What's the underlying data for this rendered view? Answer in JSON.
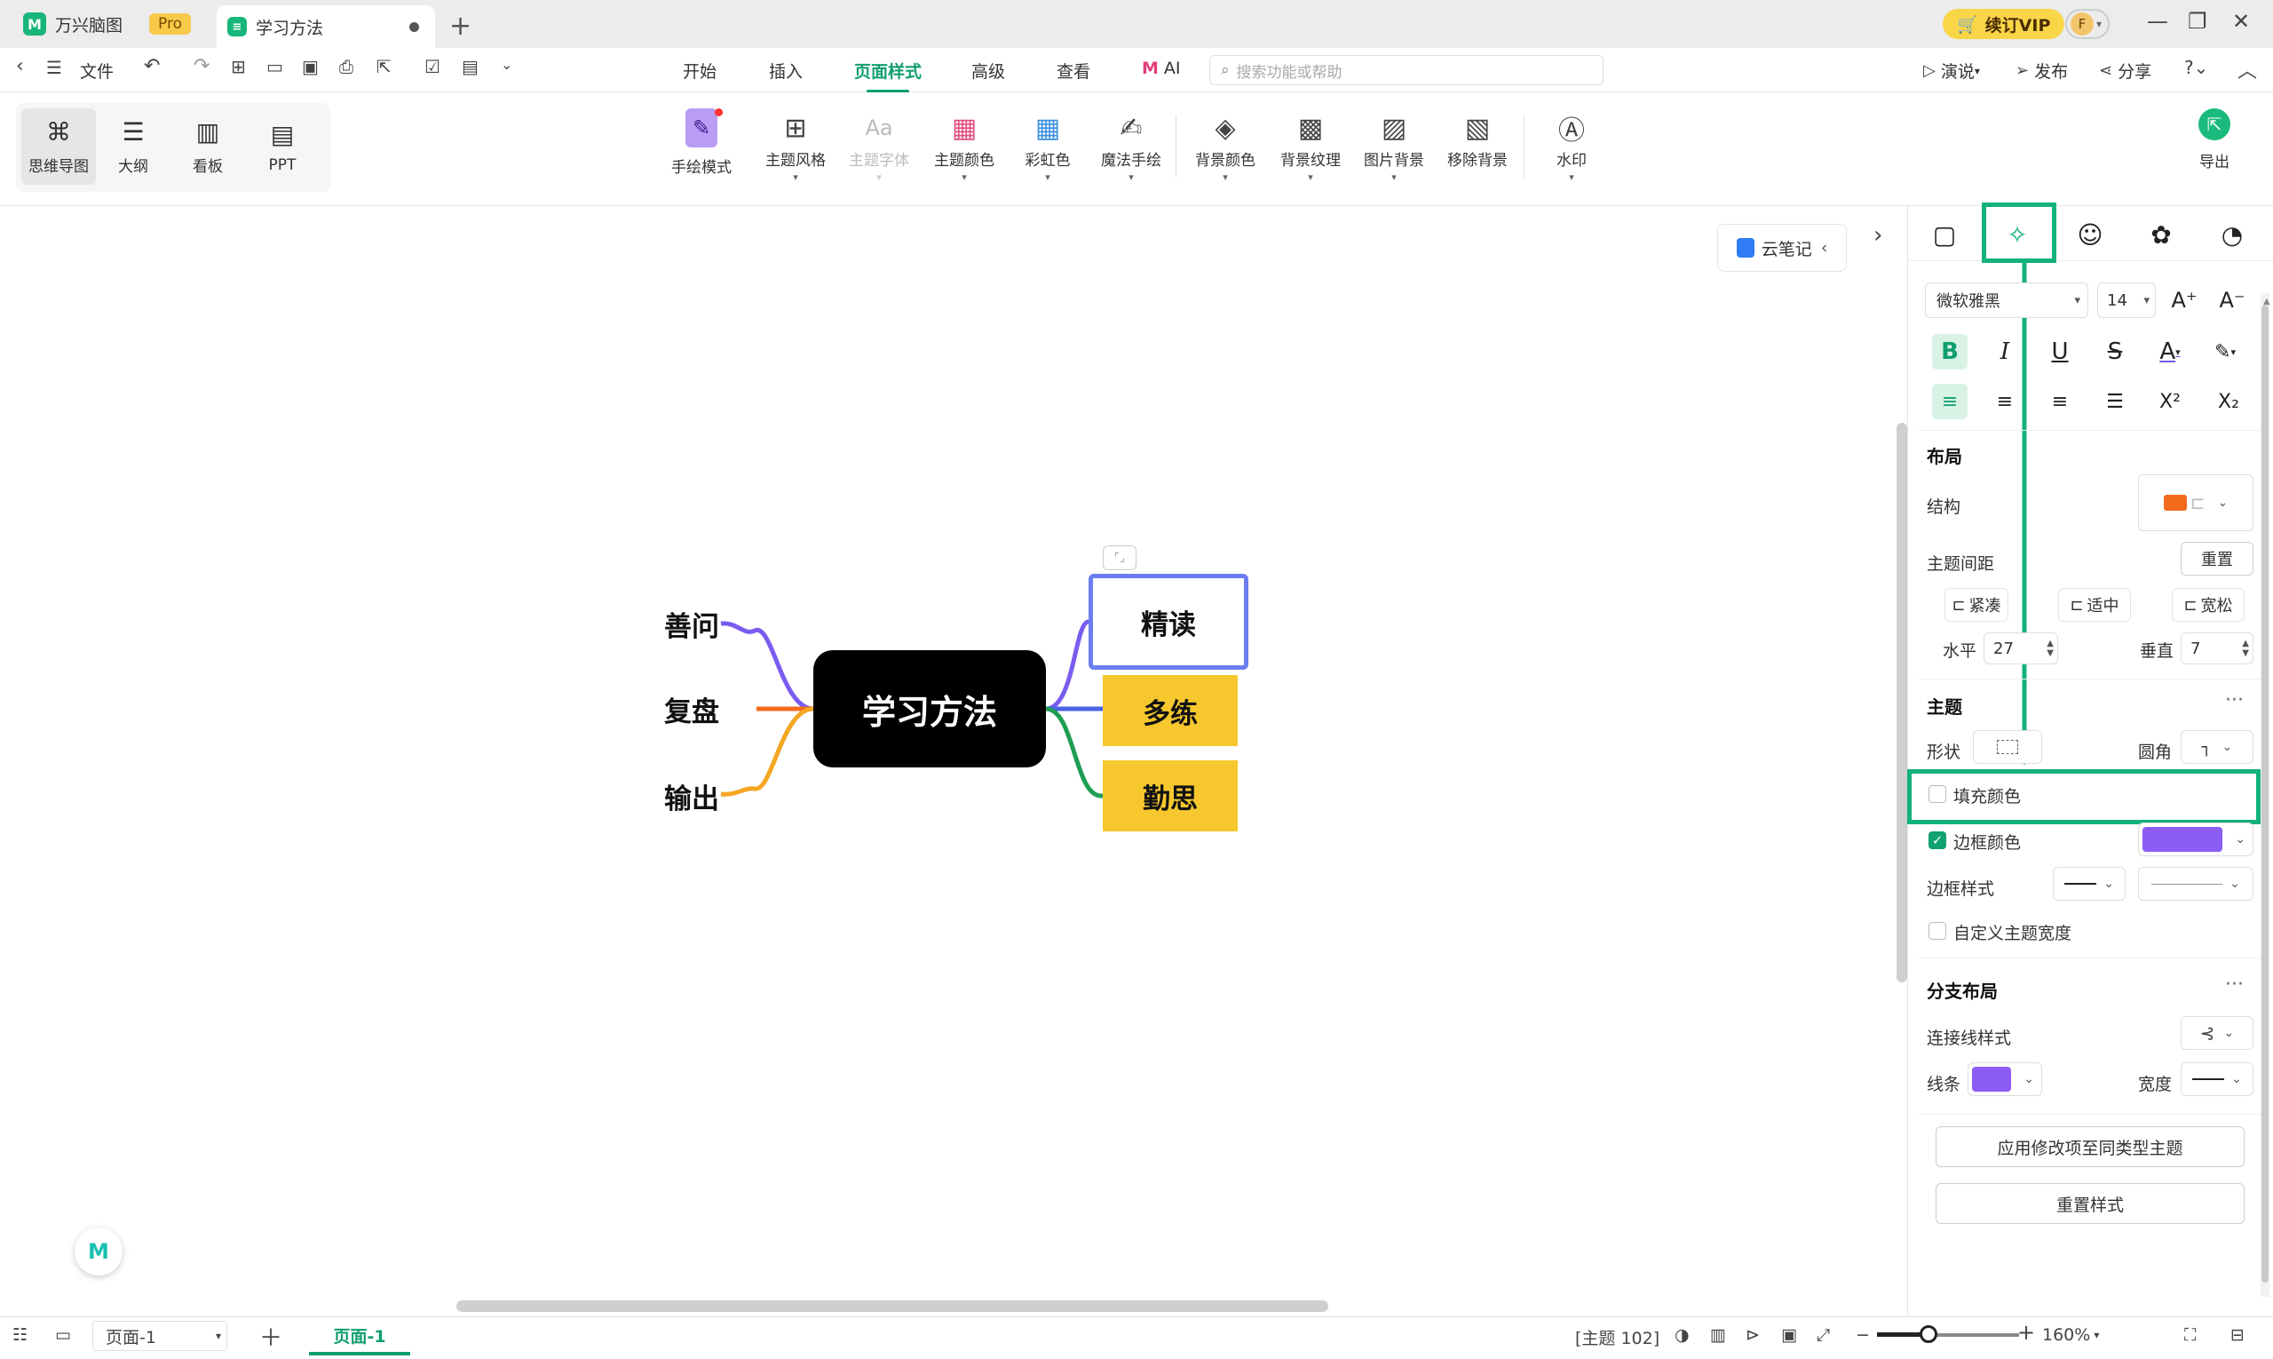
{
  "tabs": {
    "app_name": "万兴脑图",
    "pro_badge": "Pro",
    "doc_name": "学习方法",
    "new_tab": "+"
  },
  "account": {
    "vip_label": "续订VIP",
    "avatar_letter": "F"
  },
  "menu": {
    "file": "文件",
    "items": [
      "开始",
      "插入",
      "页面样式",
      "高级",
      "查看",
      "AI"
    ],
    "active": "页面样式",
    "search_placeholder": "搜索功能或帮助",
    "right": [
      "演说",
      "发布",
      "分享"
    ]
  },
  "view_modes": [
    "思维导图",
    "大纲",
    "看板",
    "PPT"
  ],
  "ribbon_tools": [
    "手绘模式",
    "主题风格",
    "主题字体",
    "主题颜色",
    "彩虹色",
    "魔法手绘",
    "背景颜色",
    "背景纹理",
    "图片背景",
    "移除背景",
    "水印"
  ],
  "export_label": "导出",
  "cloud_note": "云笔记",
  "mindmap": {
    "central": "学习方法",
    "left": [
      "善问",
      "复盘",
      "输出"
    ],
    "right": [
      "精读",
      "多练",
      "勤思"
    ],
    "colors": {
      "purple": "#7b5cf0",
      "orange": "#f26b1d",
      "amber": "#f5a623",
      "blue": "#4a63e6",
      "green": "#1e9e52",
      "yellow": "#f7c82e",
      "selected_border": "#6b7df0"
    }
  },
  "panel": {
    "font_family": "微软雅黑",
    "font_size": "14",
    "layout_heading": "布局",
    "structure_label": "结构",
    "spacing_label": "主题间距",
    "reset_label": "重置",
    "spacing_options": [
      "紧凑",
      "适中",
      "宽松"
    ],
    "horizontal_label": "水平",
    "horizontal_value": "27",
    "vertical_label": "垂直",
    "vertical_value": "7",
    "topic_heading": "主题",
    "shape_label": "形状",
    "corner_label": "圆角",
    "fill_color_label": "填充颜色",
    "border_color_label": "边框颜色",
    "border_color": "#8b5cf6",
    "border_style_label": "边框样式",
    "custom_width_label": "自定义主题宽度",
    "branch_heading": "分支布局",
    "connector_label": "连接线样式",
    "line_label": "线条",
    "line_color": "#8b5cf6",
    "width_label": "宽度",
    "apply_button": "应用修改项至同类型主题",
    "reset_style_button": "重置样式",
    "accent_color": "#13b27a"
  },
  "status": {
    "page_select": "页面-1",
    "page_tab": "页面-1",
    "topic_count": "[主题 102]",
    "zoom": "160%",
    "zoom_level": 0.36
  }
}
